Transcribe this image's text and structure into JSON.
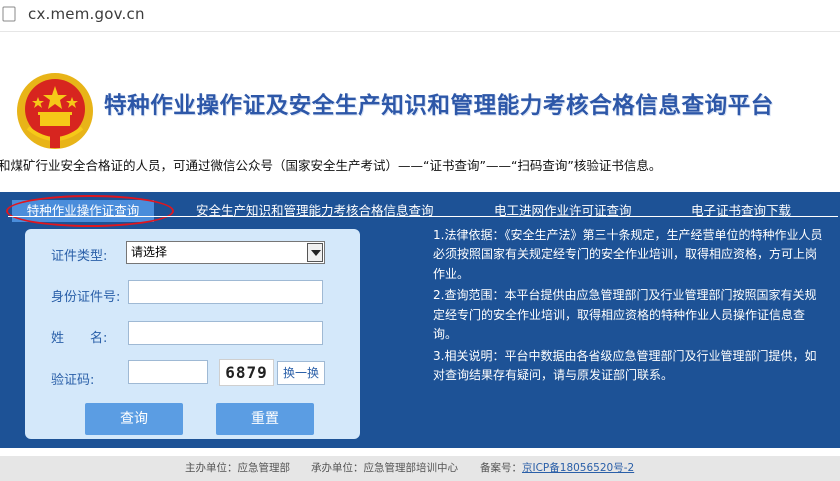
{
  "browser": {
    "url": "cx.mem.gov.cn"
  },
  "header": {
    "title": "特种作业操作证及安全生产知识和管理能力考核合格信息查询平台"
  },
  "notice": {
    "text": "和煤矿行业安全合格证的人员，可通过微信公众号（国家安全生产考试）——“证书查询”——“扫码查询”核验证书信息。"
  },
  "tabs": [
    {
      "label": "特种作业操作证查询",
      "active": true
    },
    {
      "label": "安全生产知识和管理能力考核合格信息查询",
      "active": false
    },
    {
      "label": "电工进网作业许可证查询",
      "active": false
    },
    {
      "label": "电子证书查询下载",
      "active": false
    }
  ],
  "form": {
    "cert_type_label": "证件类型:",
    "cert_type_value": "请选择",
    "id_label": "身份证件号:",
    "name_label": "姓　　名:",
    "captcha_label": "验证码:",
    "captcha_text": "6879",
    "refresh_label": "换一换",
    "query_label": "查询",
    "reset_label": "重置"
  },
  "info": [
    "1.法律依据：《安全生产法》第三十条规定，生产经营单位的特种作业人员必须按照国家有关规定经专门的安全作业培训，取得相应资格，方可上岗作业。",
    "2.查询范围：本平台提供由应急管理部门及行业管理部门按照国家有关规定经专门的安全作业培训，取得相应资格的特种作业人员操作证信息查询。",
    "3.相关说明：平台中数据由各省级应急管理部门及行业管理部门提供，如对查询结果存有疑问，请与原发证部门联系。"
  ],
  "footer": {
    "sponsor": "主办单位：应急管理部",
    "organizer": "承办单位：应急管理部培训中心",
    "icp_label": "备案号：",
    "icp_number": "京ICP备18056520号-2"
  },
  "colors": {
    "panel": "#1d5296",
    "title": "#2d57a8",
    "active_tab": "#4a8ddb",
    "highlight": "#e0161e"
  }
}
